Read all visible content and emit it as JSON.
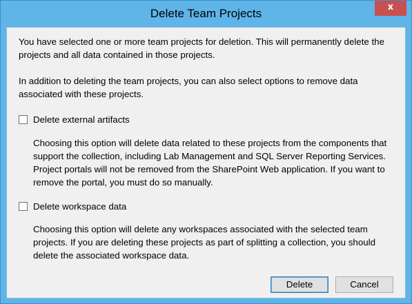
{
  "window": {
    "title": "Delete Team Projects",
    "close_glyph": "x"
  },
  "content": {
    "intro_paragraph": "You have selected one or more team projects for deletion. This will permanently delete the projects and all data contained in those projects.",
    "options_paragraph": "In addition to deleting the team projects, you can also select options to remove data associated with these projects.",
    "options": [
      {
        "label": "Delete external artifacts",
        "checked": false,
        "description": "Choosing this option will delete data related to these projects from the components that support the collection, including Lab Management and SQL Server Reporting Services. Project portals will not be removed from the SharePoint Web application. If you want to remove the portal, you must do so manually."
      },
      {
        "label": "Delete workspace data",
        "checked": false,
        "description": "Choosing this option will delete any workspaces associated with the selected team projects. If you are deleting these projects as part of splitting a collection, you should delete the associated workspace data."
      }
    ]
  },
  "buttons": {
    "delete_label": "Delete",
    "cancel_label": "Cancel"
  },
  "colors": {
    "frame": "#5fb4e8",
    "close_button": "#c75050",
    "client_background": "#f0f0f0",
    "button_face": "#e1e1e1"
  }
}
